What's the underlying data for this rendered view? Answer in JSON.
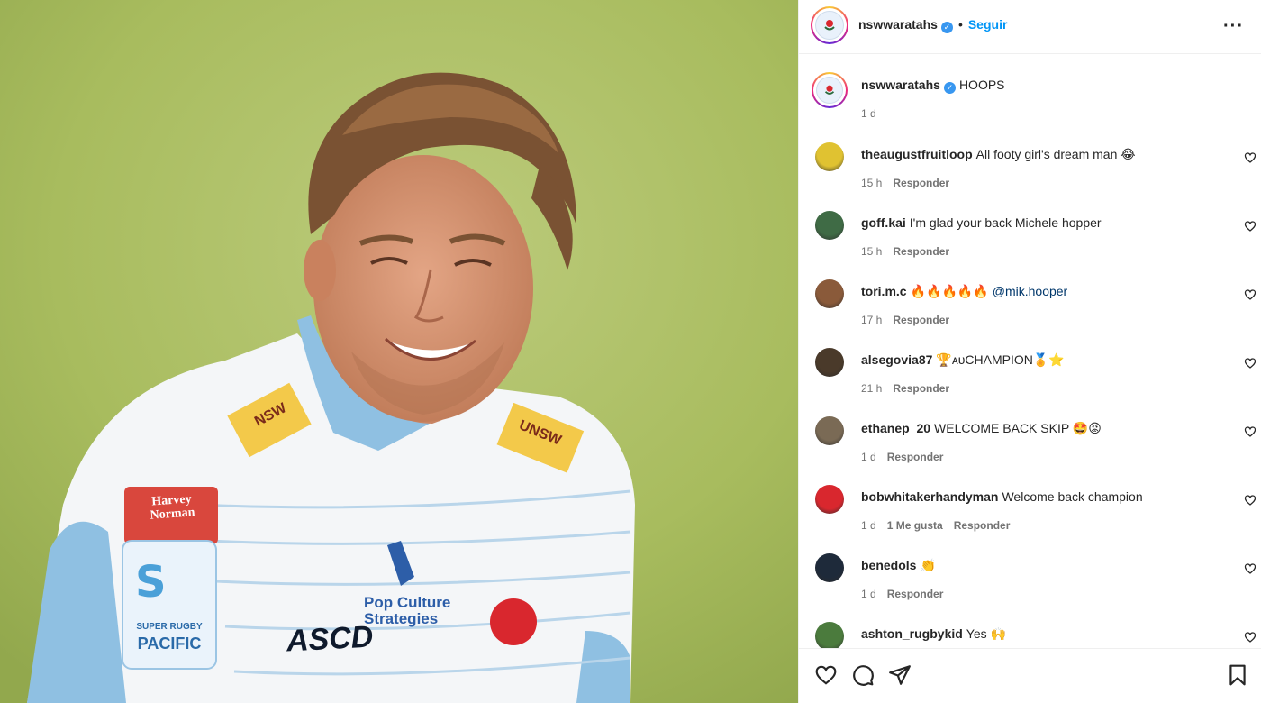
{
  "post": {
    "author": "nswwaratahs",
    "follow_label": "Seguir",
    "more_label": "···",
    "caption_text": "HOOPS",
    "caption_time": "1 d"
  },
  "reply_label": "Responder",
  "comments": [
    {
      "user": "theaugustfruitloop",
      "text": "All footy girl's dream man 😂",
      "time": "15 h",
      "avatar_color": "#e0c231"
    },
    {
      "user": "goff.kai",
      "text": "I'm glad your back Michele hopper",
      "time": "15 h",
      "avatar_color": "#3f6b45"
    },
    {
      "user": "tori.m.c",
      "text": "🔥🔥🔥🔥🔥",
      "mention": "@mik.hooper",
      "time": "17 h",
      "avatar_color": "#8a5a3a"
    },
    {
      "user": "alsegovia87",
      "text": "🏆ᴀᴜCHAMPION🏅⭐",
      "time": "21 h",
      "avatar_color": "#4a3a2a"
    },
    {
      "user": "ethanep_20",
      "text": "WELCOME BACK SKIP 🤩😡",
      "time": "1 d",
      "avatar_color": "#7a6a55"
    },
    {
      "user": "bobwhitakerhandyman",
      "text": "Welcome back champion",
      "time": "1 d",
      "likes": "1 Me gusta",
      "avatar_color": "#d9272e"
    },
    {
      "user": "benedols",
      "text": "👏",
      "time": "1 d",
      "avatar_color": "#1e2a3a"
    },
    {
      "user": "ashton_rugbykid",
      "text": "Yes 🙌",
      "time": "",
      "avatar_color": "#4b7b3d"
    }
  ],
  "photo": {
    "jersey_badge": "Harvey Norman",
    "jersey_sponsor": "Pop Culture Strategies",
    "jersey_league_1": "SUPER RUGBY",
    "jersey_league_2": "PACIFIC",
    "jersey_brand": "ASCD",
    "jersey_shoulder_left": "NSW",
    "jersey_shoulder_right": "UNSW"
  },
  "colors": {
    "accent": "#0095f6",
    "verified": "#3897f0",
    "mention": "#00376b"
  }
}
